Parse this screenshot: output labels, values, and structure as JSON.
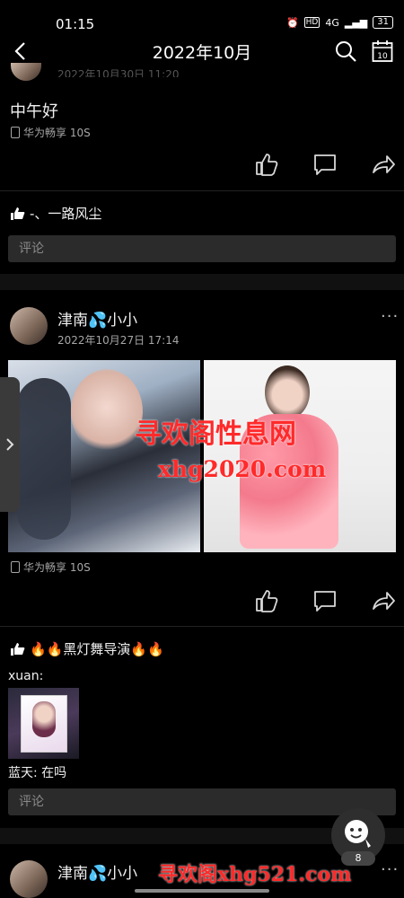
{
  "status_bar": {
    "time": "01:15",
    "hd": "HD",
    "signal": "4G",
    "battery": "31"
  },
  "header": {
    "title": "2022年10月"
  },
  "post1": {
    "timestamp_partial": "2022年10月30日 11:20",
    "text": "中午好",
    "device": "华为畅享 10S",
    "likes": "-、一路风尘",
    "comment_placeholder": "评论"
  },
  "post2": {
    "author": "津南💦小小",
    "timestamp": "2022年10月27日 17:14",
    "device": "华为畅享 10S",
    "likes": "🔥🔥黑灯舞导演🔥🔥",
    "comments": [
      {
        "author": "xuan:",
        "text": ""
      },
      {
        "author": "蓝天:",
        "text": " 在吗"
      }
    ],
    "comment_placeholder": "评论"
  },
  "post3": {
    "author": "津南💦小小"
  },
  "watermarks": {
    "overlay1": "寻欢阁性息网",
    "overlay2": "xhg2020.com",
    "footer": "寻欢阁xhg521.com"
  },
  "fab": {
    "badge": "8"
  },
  "colors": {
    "background": "#000000",
    "comment_box": "#2b2b2b",
    "watermark": "#ff2a2a"
  }
}
